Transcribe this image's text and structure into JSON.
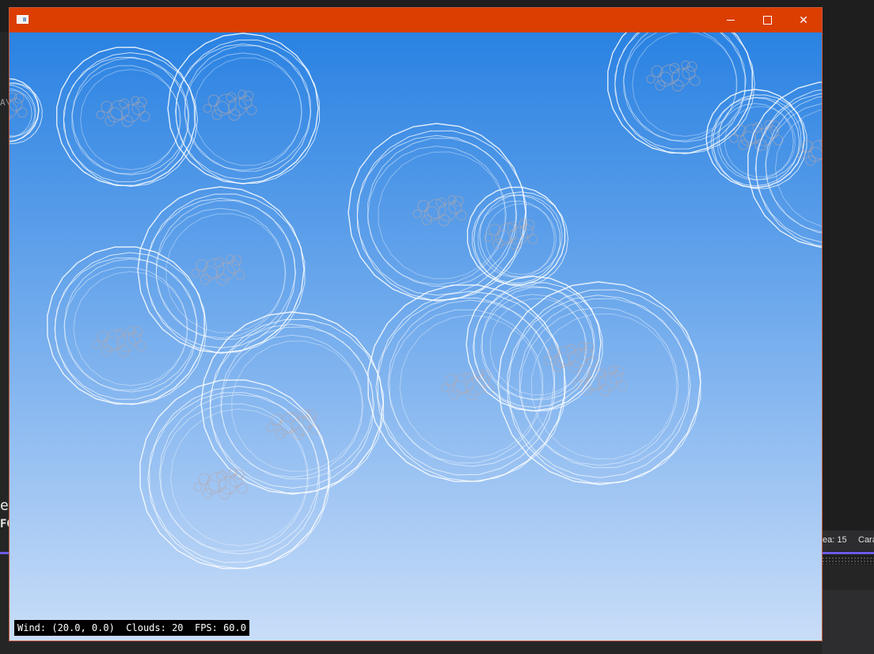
{
  "window": {
    "title": ""
  },
  "hud": {
    "text": "Wind: (20.0, 0.0)  Clouds: 20  FPS: 60.0"
  },
  "ide_background": {
    "fragments": [
      "A\\E",
      "eC",
      "FG"
    ],
    "status_items": [
      "ea: 15",
      "Cara"
    ]
  },
  "colors": {
    "titlebar": "#db3e00",
    "sky_top": "#2a82e2",
    "sky_bottom": "#c9ddf8",
    "cloud_stroke": "#ffffff",
    "hud_bg": "#000000"
  },
  "icons": {
    "app": "window-app-icon",
    "minimize": "minimize-icon",
    "maximize": "maximize-icon",
    "close": "close-icon"
  }
}
